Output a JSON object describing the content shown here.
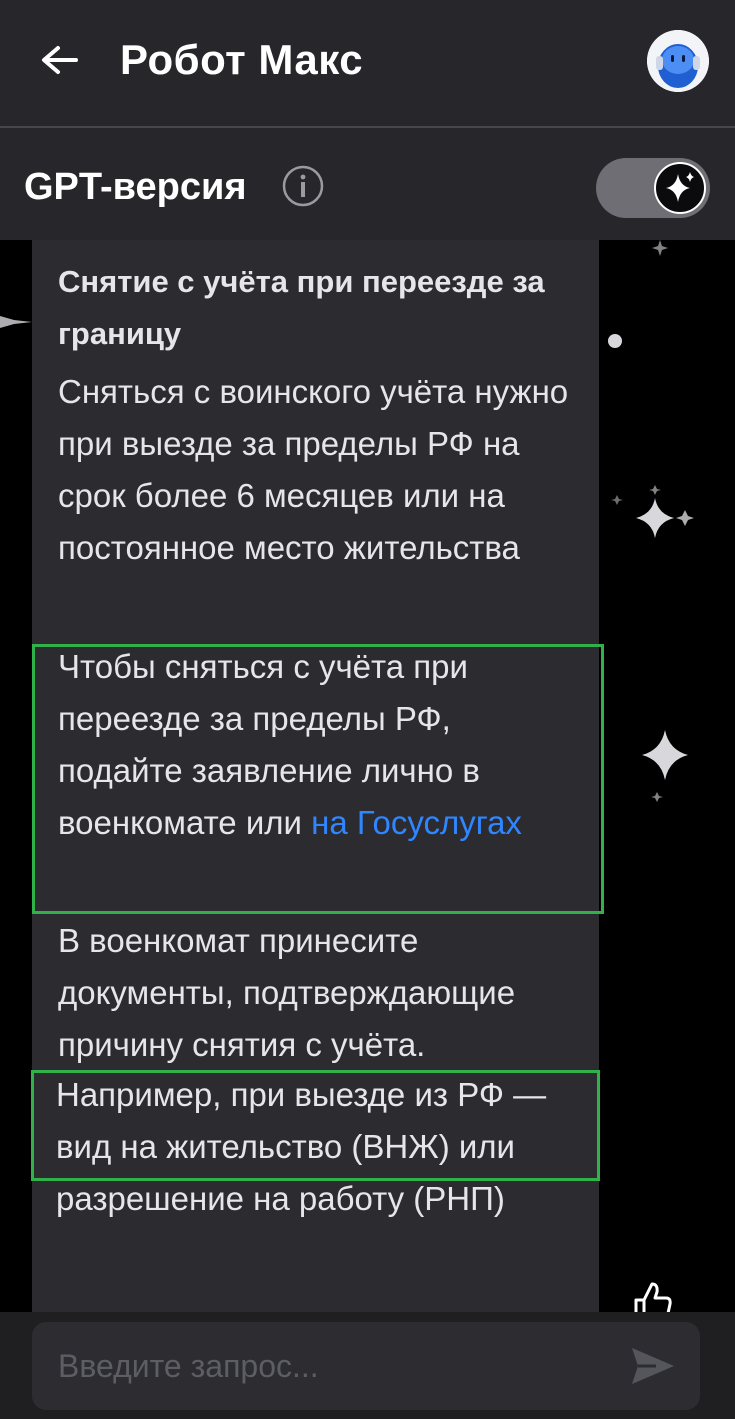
{
  "header": {
    "title": "Робот Макс"
  },
  "gpt_row": {
    "label": "GPT-версия",
    "toggle_on": true
  },
  "message": {
    "heading": "Снятие с учёта при переезде за границу",
    "paragraph1": "Сняться с воинского учёта нужно при выезде за пределы РФ на срок более 6 месяцев или на постоянное место жительства",
    "paragraph2_text": "Чтобы сняться с учёта при переезде за пределы РФ, подайте заявление лично в военкомате или ",
    "paragraph2_link": "на Госуслугах",
    "paragraph3": "В военкомат принесите документы, подтверждающие причину снятия с учёта.",
    "paragraph4": "Например, при выезде из РФ — вид на жительство (ВНЖ) или разрешение на работу (РНП)"
  },
  "input": {
    "placeholder": "Введите запрос..."
  },
  "colors": {
    "header_bg": "#27272b",
    "bubble_bg": "#2b2b30",
    "link": "#2f86ff",
    "highlight_border": "#2fb24a"
  },
  "icons": [
    "back-arrow-icon",
    "robot-avatar-icon",
    "info-icon",
    "sparkle-icon",
    "send-icon",
    "thumbs-up-icon"
  ]
}
